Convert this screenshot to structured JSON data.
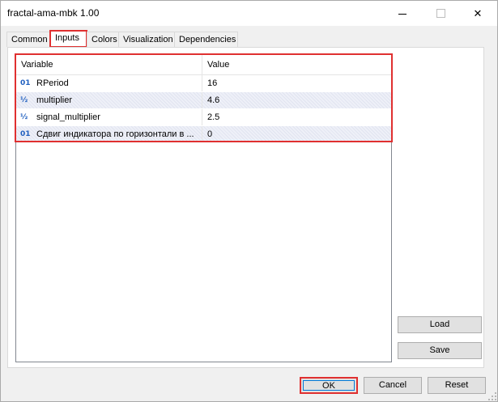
{
  "window": {
    "title": "fractal-ama-mbk 1.00",
    "close_glyph": "✕"
  },
  "tabs": [
    {
      "label": "Common"
    },
    {
      "label": "Inputs"
    },
    {
      "label": "Colors"
    },
    {
      "label": "Visualization"
    },
    {
      "label": "Dependencies"
    }
  ],
  "grid": {
    "col_variable": "Variable",
    "col_value": "Value",
    "rows": [
      {
        "icon": "01",
        "name": "RPeriod",
        "value": "16"
      },
      {
        "icon": "½",
        "name": "multiplier",
        "value": "4.6"
      },
      {
        "icon": "½",
        "name": "signal_multiplier",
        "value": "2.5"
      },
      {
        "icon": "01",
        "name": "Сдвиг индикатора по горизонтали в ...",
        "value": "0"
      }
    ]
  },
  "buttons": {
    "load": "Load",
    "save": "Save",
    "ok": "OK",
    "cancel": "Cancel",
    "reset": "Reset"
  },
  "colors": {
    "highlight": "#e03030",
    "focus": "#0078d7",
    "icon_blue": "#1f5fbf"
  }
}
